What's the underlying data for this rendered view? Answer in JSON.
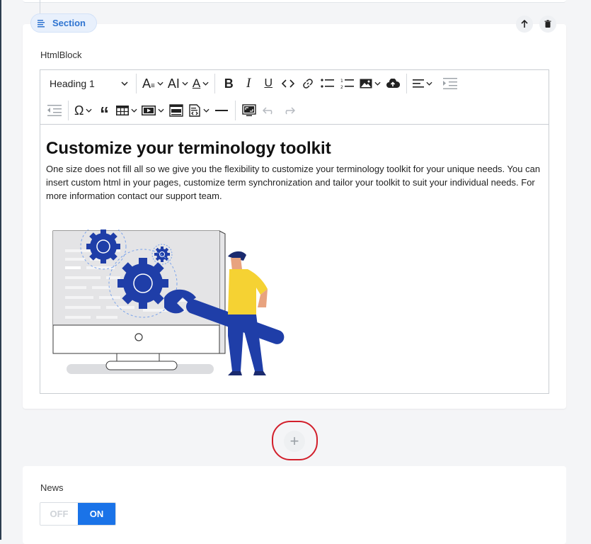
{
  "section": {
    "tag_label": "Section"
  },
  "block": {
    "label": "HtmlBlock"
  },
  "toolbar": {
    "heading_select": "Heading 1",
    "icons": {
      "font_size": "font-size-icon",
      "text_transform": "text-transform-icon",
      "font_color": "font-color-icon",
      "bold": "bold-icon",
      "italic": "italic-icon",
      "underline": "underline-icon",
      "code": "code-icon",
      "link": "link-icon",
      "bullet_list": "bullet-list-icon",
      "numbered_list": "numbered-list-icon",
      "image": "image-icon",
      "upload": "cloud-upload-icon",
      "align": "align-left-icon",
      "indent": "indent-icon",
      "outdent": "outdent-icon",
      "special_char": "omega-icon",
      "blockquote": "quote-icon",
      "table": "table-icon",
      "media": "media-icon",
      "html": "html-icon",
      "source": "source-icon",
      "hr": "horizontal-rule-icon",
      "fullscreen": "fullscreen-icon",
      "undo": "undo-icon",
      "redo": "redo-icon"
    }
  },
  "content": {
    "heading": "Customize your terminology toolkit",
    "paragraph": "One size does not fill all so we give you the flexibility to customize your terminology toolkit for your unique needs. You can insert custom html in your pages, customize term synchronization and tailor your toolkit to suit your individual needs. For more information contact our support team."
  },
  "add_section": {
    "symbol": "+"
  },
  "news": {
    "label": "News",
    "toggle_off": "OFF",
    "toggle_on": "ON",
    "value": "ON"
  },
  "colors": {
    "accent": "#1a73e8",
    "section_tag": "#2f74d0",
    "highlight": "#d21f2b",
    "illustration_blue": "#1f3ea8"
  }
}
